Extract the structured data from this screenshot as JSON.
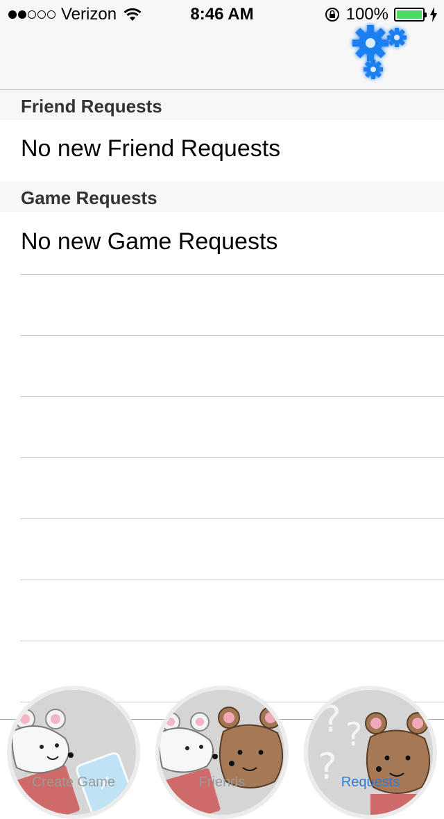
{
  "status_bar": {
    "carrier": "Verizon",
    "signal_bars_filled": 2,
    "signal_bars_total": 5,
    "time": "8:46 AM",
    "battery_percent": "100%",
    "battery_level": 1.0
  },
  "nav": {
    "settings_icon": "gears-icon",
    "accent_color": "#1a7ff0"
  },
  "sections": [
    {
      "header": "Friend Requests",
      "row": "No new Friend Requests"
    },
    {
      "header": "Game Requests",
      "row": "No new Game Requests"
    }
  ],
  "tabs": [
    {
      "label": "Create Game",
      "icon": "mouse-with-cards-icon",
      "active": false
    },
    {
      "label": "Friends",
      "icon": "two-mice-icon",
      "active": false
    },
    {
      "label": "Requests",
      "icon": "mouse-question-icon",
      "active": true
    }
  ]
}
